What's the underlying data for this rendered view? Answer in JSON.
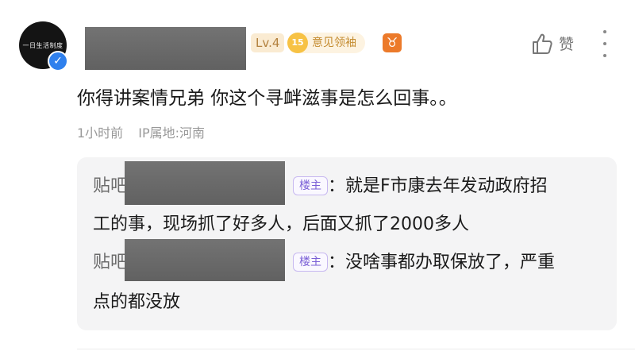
{
  "header": {
    "avatar_text": "一日生活制度",
    "verified_icon": "check-icon",
    "level_badge": "Lv.4",
    "medal_number": "15",
    "medal_label": "意见领袖",
    "zodiac_glyph": "♉",
    "like_icon": "thumbs-up-icon",
    "like_label": "赞",
    "more_icon": "more-vertical-icon"
  },
  "comment": {
    "text": "你得讲案情兄弟 你这个寻衅滋事是怎么回事。。",
    "time": "1小时前",
    "location": "IP属地:河南"
  },
  "replies": [
    {
      "name_prefix": "贴吧",
      "badge": "楼主",
      "line1": "：就是F市康去年发动政府招",
      "line2": "工的事，现场抓了好多人，后面又抓了2000多人"
    },
    {
      "name_prefix": "贴吧",
      "badge": "楼主",
      "line1": "：没啥事都办取保放了，严重",
      "line2": "点的都没放"
    }
  ],
  "colors": {
    "accent_badge": "#7a5fd6",
    "level_text": "#b3813e",
    "medal_coin": "#f7c244",
    "zodiac_bg": "#ec7a2a",
    "verified_bg": "#2f80ed"
  }
}
